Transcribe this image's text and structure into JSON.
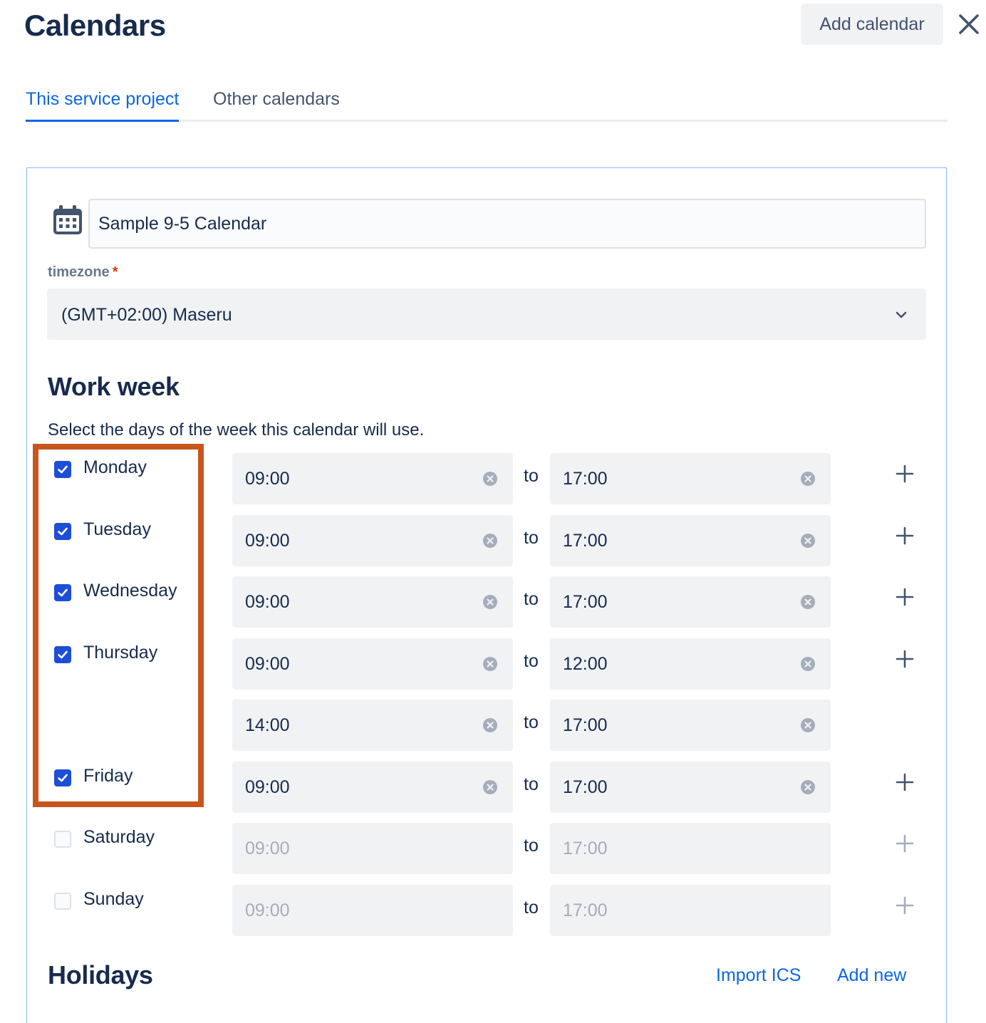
{
  "header": {
    "title": "Calendars",
    "add_calendar_label": "Add calendar"
  },
  "tabs": [
    {
      "label": "This service project",
      "active": true
    },
    {
      "label": "Other calendars",
      "active": false
    }
  ],
  "calendar": {
    "name": "Sample 9-5 Calendar",
    "timezone_label": "timezone",
    "timezone_required_mark": "*",
    "timezone_value": "(GMT+02:00) Maseru"
  },
  "work_week": {
    "title": "Work week",
    "description": "Select the days of the week this calendar will use.",
    "to_label": "to",
    "days": [
      {
        "label": "Monday",
        "checked": true,
        "ranges": [
          {
            "start": "09:00",
            "end": "17:00"
          }
        ]
      },
      {
        "label": "Tuesday",
        "checked": true,
        "ranges": [
          {
            "start": "09:00",
            "end": "17:00"
          }
        ]
      },
      {
        "label": "Wednesday",
        "checked": true,
        "ranges": [
          {
            "start": "09:00",
            "end": "17:00"
          }
        ]
      },
      {
        "label": "Thursday",
        "checked": true,
        "ranges": [
          {
            "start": "09:00",
            "end": "12:00"
          },
          {
            "start": "14:00",
            "end": "17:00"
          }
        ]
      },
      {
        "label": "Friday",
        "checked": true,
        "ranges": [
          {
            "start": "09:00",
            "end": "17:00"
          }
        ]
      },
      {
        "label": "Saturday",
        "checked": false,
        "ranges": [
          {
            "start": "09:00",
            "end": "17:00"
          }
        ]
      },
      {
        "label": "Sunday",
        "checked": false,
        "ranges": [
          {
            "start": "09:00",
            "end": "17:00"
          }
        ]
      }
    ]
  },
  "holidays": {
    "title": "Holidays",
    "import_label": "Import ICS",
    "add_new_label": "Add new"
  },
  "colors": {
    "accent": "#0c66e4",
    "checkbox": "#1d4ed8",
    "highlight": "#c8561c",
    "field_bg": "#f1f2f4",
    "text": "#172b4d",
    "required": "#de350b"
  },
  "icons": {
    "close": "close-icon",
    "calendar": "calendar-icon",
    "chevron": "chevron-down-icon",
    "clear": "clear-icon",
    "add": "plus-icon",
    "check": "check-icon"
  }
}
